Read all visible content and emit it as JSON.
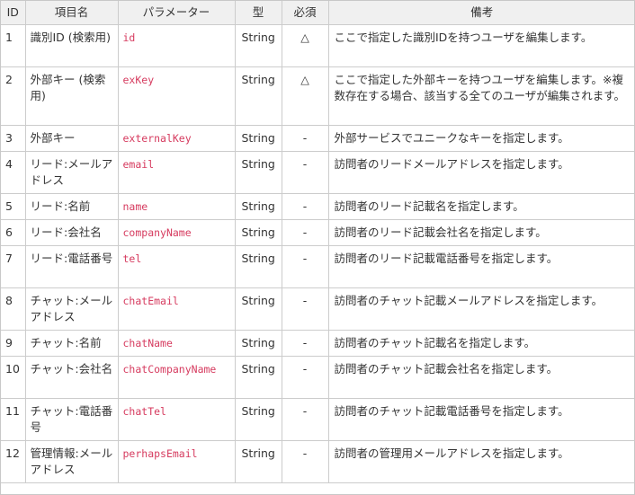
{
  "table": {
    "headers": {
      "id": "ID",
      "name": "項目名",
      "param": "パラメーター",
      "type": "型",
      "required": "必須",
      "note": "備考"
    },
    "rows": [
      {
        "id": "1",
        "name": "識別ID (検索用)",
        "param": "id",
        "type": "String",
        "required": "△",
        "note": "ここで指定した識別IDを持つユーザを編集します。"
      },
      {
        "id": "2",
        "name": "外部キー (検索用)",
        "param": "exKey",
        "type": "String",
        "required": "△",
        "note": "ここで指定した外部キーを持つユーザを編集します。※複数存在する場合、該当する全てのユーザが編集されます。"
      },
      {
        "id": "3",
        "name": "外部キー",
        "param": "externalKey",
        "type": "String",
        "required": "-",
        "note": "外部サービスでユニークなキーを指定します。"
      },
      {
        "id": "4",
        "name": "リード:メールアドレス",
        "param": "email",
        "type": "String",
        "required": "-",
        "note": "訪問者のリードメールアドレスを指定します。"
      },
      {
        "id": "5",
        "name": "リード:名前",
        "param": "name",
        "type": "String",
        "required": "-",
        "note": "訪問者のリード記載名を指定します。"
      },
      {
        "id": "6",
        "name": "リード:会社名",
        "param": "companyName",
        "type": "String",
        "required": "-",
        "note": "訪問者のリード記載会社名を指定します。"
      },
      {
        "id": "7",
        "name": "リード:電話番号",
        "param": "tel",
        "type": "String",
        "required": "-",
        "note": "訪問者のリード記載電話番号を指定します。"
      },
      {
        "id": "8",
        "name": "チャット:メールアドレス",
        "param": "chatEmail",
        "type": "String",
        "required": "-",
        "note": "訪問者のチャット記載メールアドレスを指定します。"
      },
      {
        "id": "9",
        "name": "チャット:名前",
        "param": "chatName",
        "type": "String",
        "required": "-",
        "note": "訪問者のチャット記載名を指定します。"
      },
      {
        "id": "10",
        "name": "チャット:会社名",
        "param": "chatCompanyName",
        "type": "String",
        "required": "-",
        "note": "訪問者のチャット記載会社名を指定します。"
      },
      {
        "id": "11",
        "name": "チャット:電話番号",
        "param": "chatTel",
        "type": "String",
        "required": "-",
        "note": "訪問者のチャット記載電話番号を指定します。"
      },
      {
        "id": "12",
        "name": "管理情報:メールアドレス",
        "param": "perhapsEmail",
        "type": "String",
        "required": "-",
        "note": "訪問者の管理用メールアドレスを指定します。"
      }
    ]
  },
  "colors": {
    "header_bg": "#f0f0f0",
    "border": "#cccccc",
    "param_code": "#d63b5f"
  }
}
